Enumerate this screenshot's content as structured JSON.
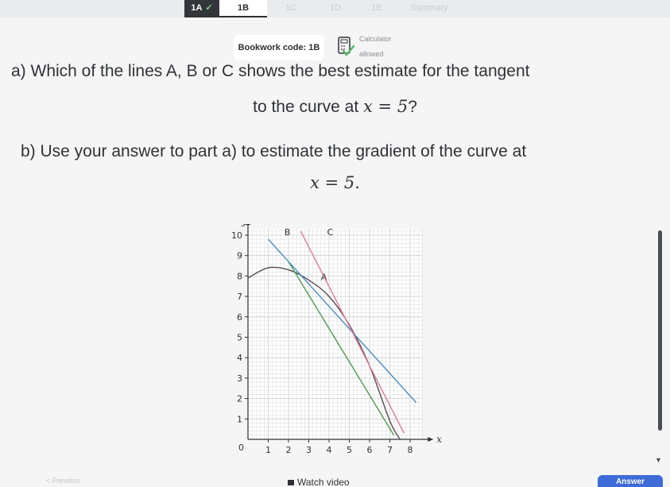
{
  "tabs": [
    {
      "label": "1A",
      "state": "done",
      "tick": "✓"
    },
    {
      "label": "1B",
      "state": "active"
    },
    {
      "label": "1C",
      "state": "inactive"
    },
    {
      "label": "1D",
      "state": "inactive"
    },
    {
      "label": "1E",
      "state": "inactive"
    },
    {
      "label": "Summary",
      "state": "inactive"
    }
  ],
  "bookwork": {
    "label": "Bookwork code: 1B"
  },
  "calculator": {
    "line1": "Calculator",
    "line2": "allowed",
    "icon": "calculator-allowed-icon"
  },
  "question": {
    "a_line1": "a) Which of the lines A, B or C shows the best estimate for the tangent",
    "a_line2_text": "to the curve at ",
    "a_line2_math": "x = 5",
    "a_line2_end": "?",
    "b_line1": "b) Use your answer to part a) to estimate the gradient of the curve at",
    "b_line2_math": "x = 5."
  },
  "bottom": {
    "previous": "< Previous",
    "watch_video": "Watch video",
    "answer": "Answer"
  },
  "chart_data": {
    "type": "line",
    "xlabel": "x",
    "ylabel": "y",
    "xlim": [
      0,
      8.6
    ],
    "ylim": [
      0,
      10.3
    ],
    "xticks": [
      "1",
      "2",
      "3",
      "4",
      "5",
      "6",
      "7",
      "8"
    ],
    "yticks": [
      "1",
      "2",
      "3",
      "4",
      "5",
      "6",
      "7",
      "8",
      "9",
      "10"
    ],
    "origin_label": "0",
    "grid": true,
    "curve": {
      "x": [
        0,
        1,
        2,
        3,
        4,
        5,
        6,
        7,
        7.5
      ],
      "y": [
        7.9,
        8.4,
        8.3,
        7.8,
        7.0,
        5.6,
        3.6,
        0.9,
        0
      ]
    },
    "series": [
      {
        "name": "A",
        "color": "#4e9b4e",
        "x": [
          2,
          7.2
        ],
        "y": [
          8.7,
          0.2
        ]
      },
      {
        "name": "B",
        "color": "#4a8fc4",
        "x": [
          1,
          8.3
        ],
        "y": [
          9.8,
          1.8
        ]
      },
      {
        "name": "C",
        "color": "#e07a9a",
        "x": [
          2.6,
          7.7
        ],
        "y": [
          10.2,
          0.3
        ]
      }
    ],
    "colors": {
      "curve": "#5a4b4b",
      "grid": "#c8cccf",
      "axes": "#2f3338"
    }
  }
}
